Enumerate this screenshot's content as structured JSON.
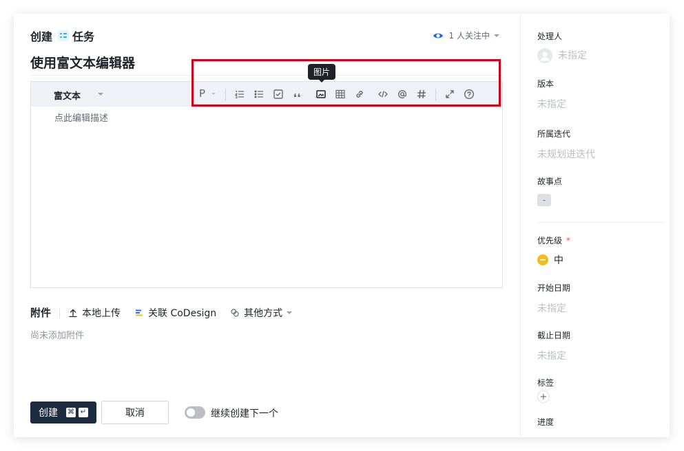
{
  "header": {
    "create_label": "创建",
    "type_label": "任务",
    "watch_label": "1 人关注中"
  },
  "title": "使用富文本编辑器",
  "editor": {
    "format_label": "富文本",
    "paragraph_label": "P",
    "placeholder": "点此编辑描述",
    "tooltip": "图片"
  },
  "attachments": {
    "title": "附件",
    "upload_label": "本地上传",
    "codesign_label": "关联 CoDesign",
    "other_label": "其他方式",
    "empty_text": "尚未添加附件"
  },
  "footer": {
    "create_label": "创建",
    "cmd_key": "⌘",
    "enter_key": "↵",
    "cancel_label": "取消",
    "continue_label": "继续创建下一个"
  },
  "sidebar": {
    "assignee": {
      "label": "处理人",
      "value": "未指定"
    },
    "version": {
      "label": "版本",
      "value": "未指定"
    },
    "iteration": {
      "label": "所属迭代",
      "value": "未规划进迭代"
    },
    "story_points": {
      "label": "故事点",
      "value": "-"
    },
    "priority": {
      "label": "优先级",
      "required_mark": "*",
      "value": "中"
    },
    "start_date": {
      "label": "开始日期",
      "value": "未指定"
    },
    "due_date": {
      "label": "截止日期",
      "value": "未指定"
    },
    "tags": {
      "label": "标签",
      "add": "+"
    },
    "progress": {
      "label": "进度"
    }
  },
  "colors": {
    "accent": "#2aa9e0",
    "primary_button": "#1c2b3f",
    "highlight_box": "#d0021b",
    "priority_medium": "#f7ba1e"
  }
}
